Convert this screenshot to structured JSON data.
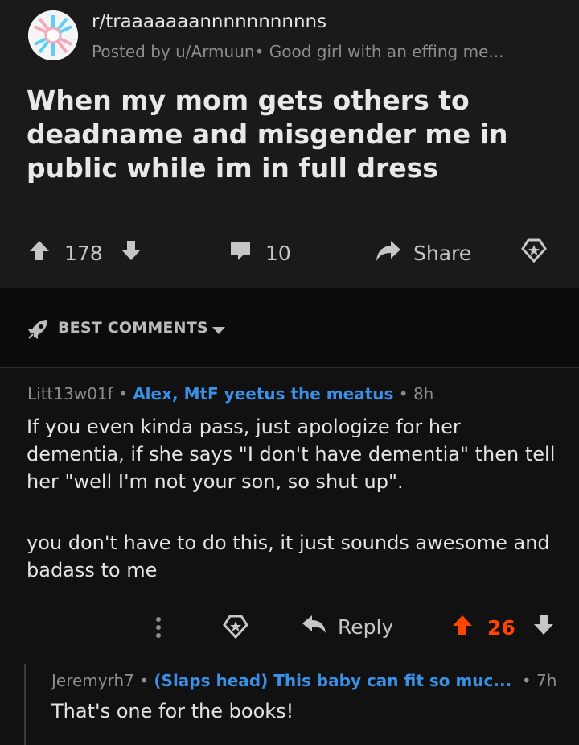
{
  "post": {
    "subreddit": "r/traaaaaaannnnnnnnnns",
    "posted_by": "Posted by u/Armuun",
    "flair": "Good girl with an effing me...",
    "title": "When my mom gets others to deadname and misgender me in public while im in full dress",
    "upvotes": "178",
    "comments": "10",
    "share_label": "Share"
  },
  "sort": {
    "label": "BEST COMMENTS"
  },
  "comment": {
    "author": "Litt13w01f",
    "flair": "Alex, MtF yeetus the meatus",
    "age": "8h",
    "paragraphs": [
      "If you even kinda pass, just apologize for her dementia, if she says \"I don't have dementia\" then tell her \"well I'm not your son, so shut up\".",
      "you don't have to do this, it just sounds awesome and badass to me"
    ],
    "reply_label": "Reply",
    "score": "26",
    "accent_color": "#ff4500"
  },
  "reply": {
    "author": "Jeremyrh7",
    "flair": "(Slaps head) This baby can fit so muc...",
    "age": "7h",
    "body": "That's one for the books!"
  }
}
